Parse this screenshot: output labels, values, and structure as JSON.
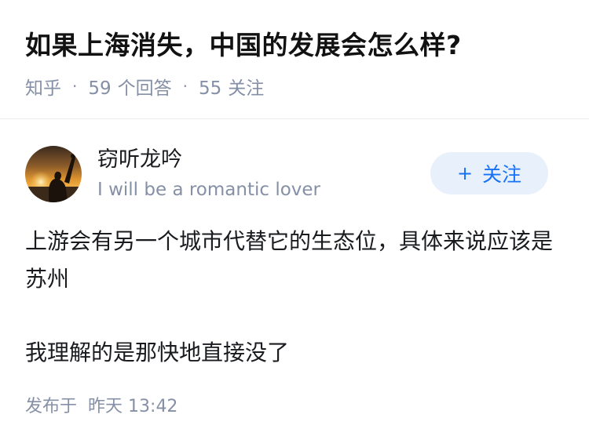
{
  "question": {
    "title": "如果上海消失，中国的发展会怎么样?",
    "source": "知乎",
    "answer_count": "59",
    "answer_label": "个回答",
    "follow_count": "55",
    "follow_label": "关注"
  },
  "answer": {
    "author": {
      "name": "窃听龙吟",
      "bio": "I will be a romantic lover",
      "avatar_icon": "sunset-silhouette-avatar"
    },
    "follow_button": {
      "icon": "+",
      "label": "关注"
    },
    "paragraphs": [
      "上游会有另一个城市代替它的生态位，具体来说应该是苏州",
      "我理解的是那快地直接没了"
    ],
    "publish": {
      "label": "发布于",
      "day": "昨天",
      "time": "13:42"
    }
  },
  "colors": {
    "meta_gray": "#8590a6",
    "accent_blue": "#1772f6",
    "button_bg": "#e8f1fb",
    "text": "#191b1f"
  }
}
